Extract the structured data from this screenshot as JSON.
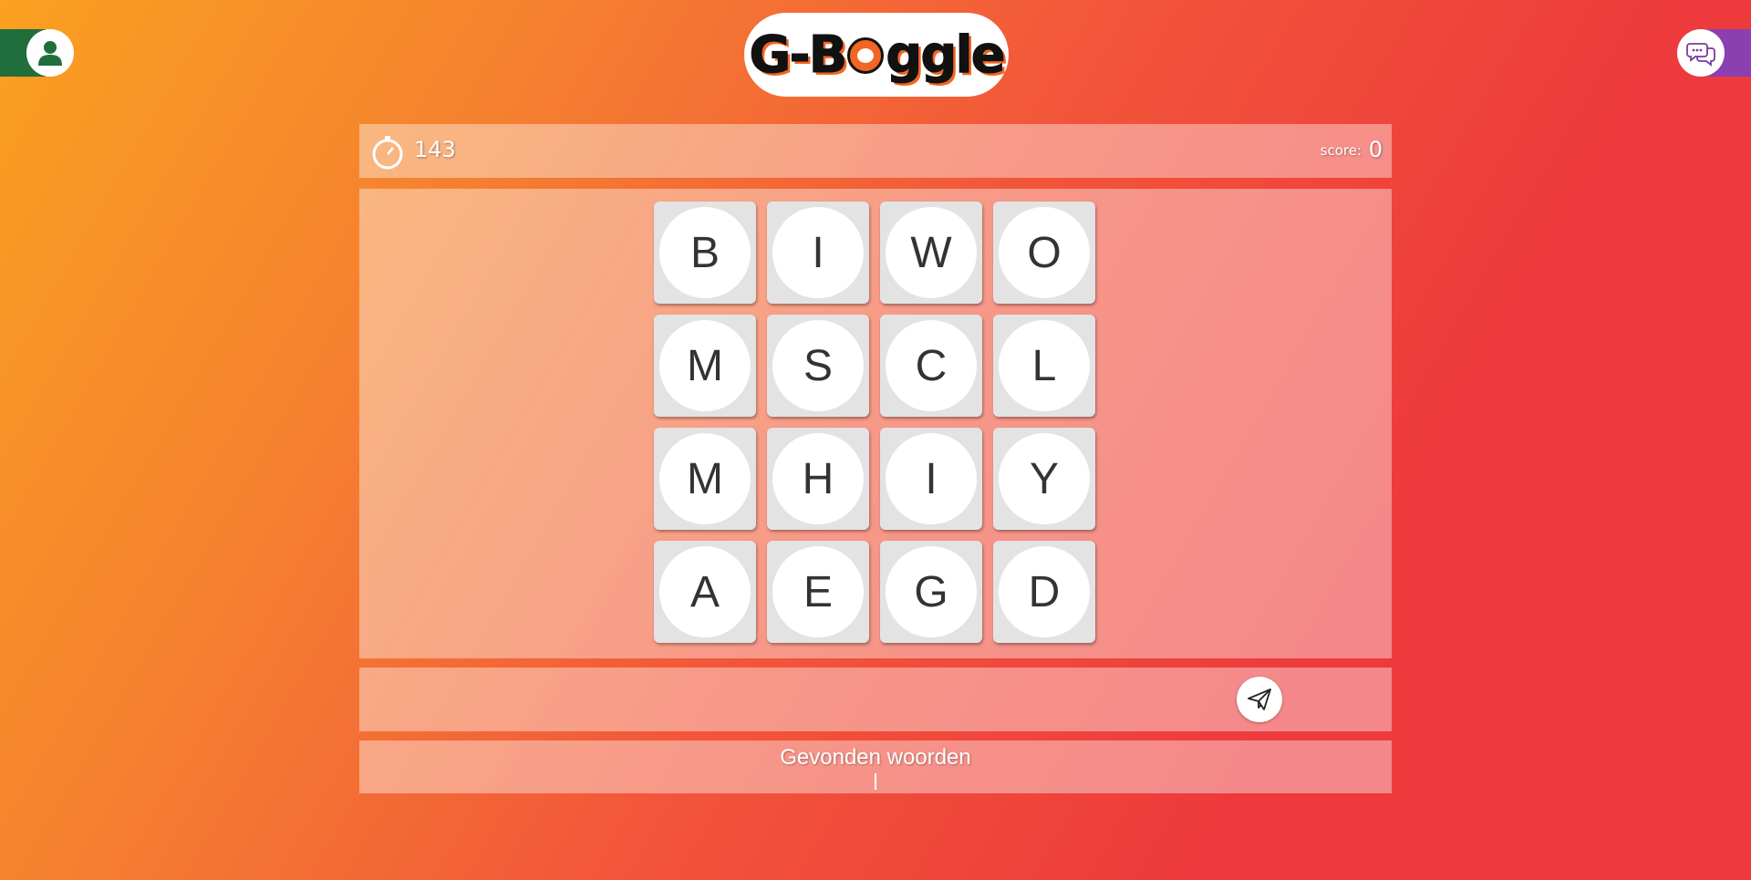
{
  "header": {
    "logo_text_before": "G-B",
    "logo_text_after": "ggle",
    "logo_alt": "G-Boggle"
  },
  "status": {
    "timer": "143",
    "score_label": "score:",
    "score": "0"
  },
  "board": {
    "tiles": [
      "B",
      "I",
      "W",
      "O",
      "M",
      "S",
      "C",
      "L",
      "M",
      "H",
      "I",
      "Y",
      "A",
      "E",
      "G",
      "D"
    ]
  },
  "input": {
    "value": "",
    "placeholder": ""
  },
  "found": {
    "title": "Gevonden woorden"
  },
  "colors": {
    "profile_accent": "#1f6e3b",
    "chat_accent": "#8b3fb0",
    "brand_orange": "#f26522"
  },
  "icons": {
    "profile": "user-icon",
    "chat": "chat-bubbles-icon",
    "timer": "stopwatch-icon",
    "send": "paper-plane-icon"
  }
}
